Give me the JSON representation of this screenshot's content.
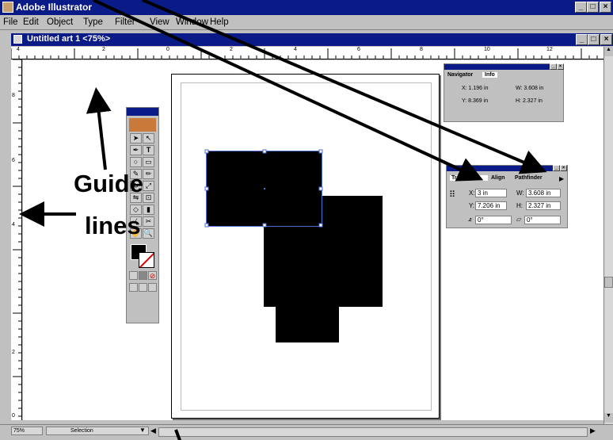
{
  "app": {
    "title": "Adobe Illustrator"
  },
  "menu": [
    "File",
    "Edit",
    "Object",
    "Type",
    "Filter",
    "View",
    "Window",
    "Help"
  ],
  "document": {
    "title": "Untitled art 1 <75%>"
  },
  "ruler_top": [
    "4",
    "2",
    "0",
    "2",
    "4",
    "6",
    "8",
    "10",
    "12"
  ],
  "ruler_left": [
    "8",
    "6",
    "4",
    "2",
    "0"
  ],
  "navigator": {
    "tabs": [
      "Navigator",
      "Info"
    ],
    "x": "X: 1.196 in",
    "y": "Y: 8.369 in",
    "w": "W: 3.608 in",
    "h": "H: 2.327 in"
  },
  "transform": {
    "tabs": [
      "Transform",
      "Align",
      "Pathfinder"
    ],
    "x_label": "X:",
    "x": "3 in",
    "y_label": "Y:",
    "y": "7.206 in",
    "w_label": "W:",
    "w": "3.608 in",
    "h_label": "H:",
    "h": "2.327 in",
    "angle": "0°",
    "shear": "0°"
  },
  "annotation": {
    "line1": "Guide",
    "line2": "lines"
  },
  "status": {
    "zoom": "75%",
    "tool": "Selection"
  }
}
